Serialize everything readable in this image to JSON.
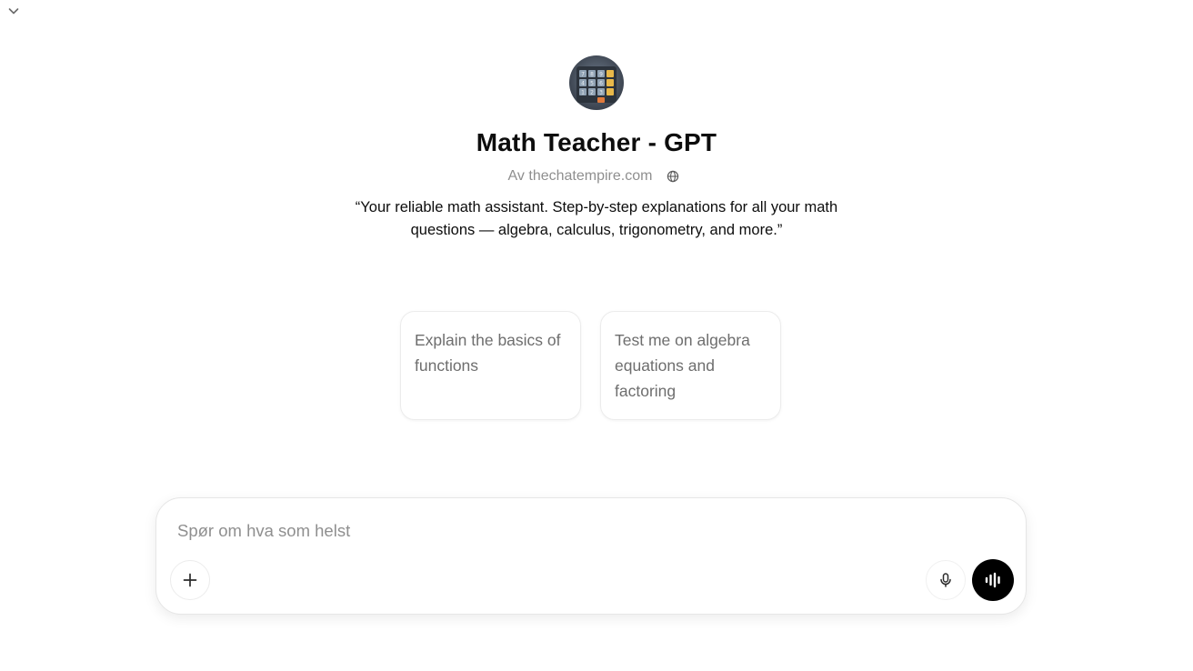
{
  "header": {
    "collapse_icon": "chevron-down-icon"
  },
  "gpt": {
    "avatar_icon": "calculator-icon",
    "title": "Math Teacher - GPT",
    "author": "Av thechatempire.com",
    "author_link_icon": "globe-icon",
    "description": "“Your reliable math assistant. Step-by-step explanations for all your math questions — algebra, calculus, trigonometry, and more.”"
  },
  "starters": [
    {
      "label": "Explain the basics of functions"
    },
    {
      "label": "Test me on algebra equations and factoring"
    }
  ],
  "composer": {
    "placeholder": "Spør om hva som helst",
    "value": "",
    "add_icon": "plus-icon",
    "mic_icon": "microphone-icon",
    "voice_icon": "voice-mode-icon"
  },
  "colors": {
    "text_primary": "#0d0d0d",
    "text_muted": "#8f8f8f",
    "card_border": "#ececec",
    "voice_button_bg": "#000000"
  }
}
